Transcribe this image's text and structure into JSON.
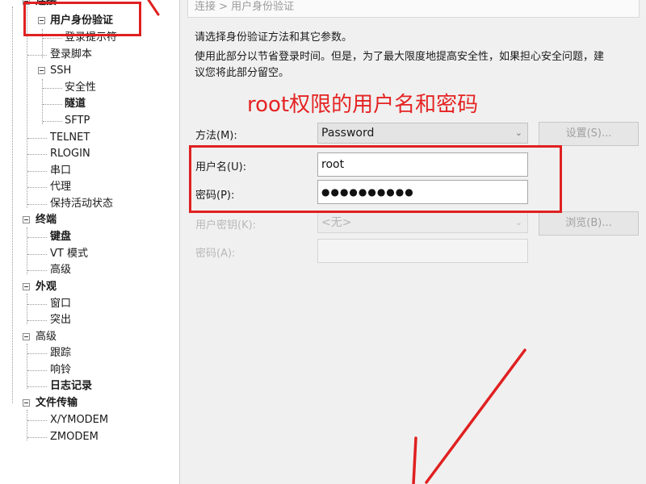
{
  "tree": {
    "items": [
      {
        "label": "连接",
        "bold": true
      },
      {
        "label": "用户身份验证",
        "bold": true
      },
      {
        "label": "登录提示符",
        "bold": false
      },
      {
        "label": "登录脚本",
        "bold": false
      },
      {
        "label": "SSH",
        "bold": false
      },
      {
        "label": "安全性",
        "bold": false
      },
      {
        "label": "隧道",
        "bold": true
      },
      {
        "label": "SFTP",
        "bold": false
      },
      {
        "label": "TELNET",
        "bold": false
      },
      {
        "label": "RLOGIN",
        "bold": false
      },
      {
        "label": "串口",
        "bold": false
      },
      {
        "label": "代理",
        "bold": false
      },
      {
        "label": "保持活动状态",
        "bold": false
      },
      {
        "label": "终端",
        "bold": true
      },
      {
        "label": "键盘",
        "bold": true
      },
      {
        "label": "VT 模式",
        "bold": false
      },
      {
        "label": "高级",
        "bold": false
      },
      {
        "label": "外观",
        "bold": true
      },
      {
        "label": "窗口",
        "bold": false
      },
      {
        "label": "突出",
        "bold": false
      },
      {
        "label": "高级",
        "bold": false
      },
      {
        "label": "跟踪",
        "bold": false
      },
      {
        "label": "响铃",
        "bold": false
      },
      {
        "label": "日志记录",
        "bold": true
      },
      {
        "label": "文件传输",
        "bold": true
      },
      {
        "label": "X/YMODEM",
        "bold": false
      },
      {
        "label": "ZMODEM",
        "bold": false
      }
    ]
  },
  "panel": {
    "breadcrumb": "连接 > 用户身份验证",
    "desc1": "请选择身份验证方法和其它参数。",
    "desc2_line1": "使用此部分以节省登录时间。但是，为了最大限度地提高安全性，如果担心安全问题，建",
    "desc2_line2": "议您将此部分留空。",
    "method_label": "方法(M):",
    "method_value": "Password",
    "settings_button": "设置(S)...",
    "username_label": "用户名(U):",
    "username_value": "root",
    "password_label": "密码(P):",
    "password_value": "●●●●●●●●●●",
    "userkey_label": "用户密钥(K):",
    "userkey_value": "<无>",
    "browse_button": "浏览(B)...",
    "passphrase_label": "密码(A):",
    "passphrase_value": ""
  },
  "annotation": {
    "text": "root权限的用户名和密码",
    "color": "#e52323"
  }
}
